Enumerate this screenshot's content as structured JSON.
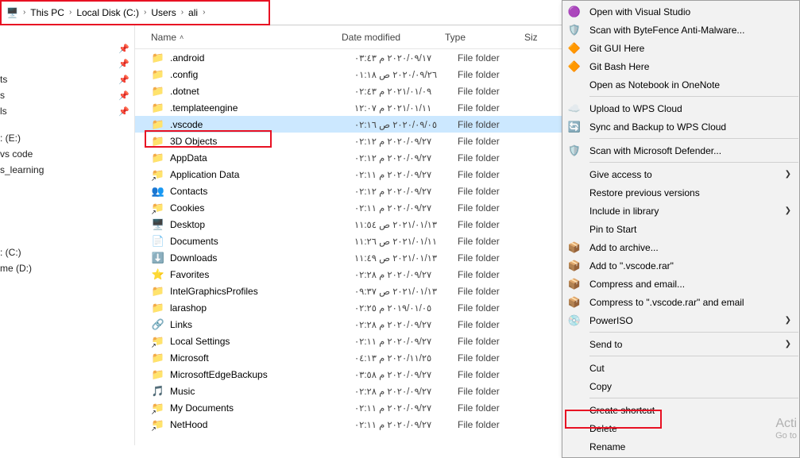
{
  "breadcrumb": {
    "parts": [
      "This PC",
      "Local Disk (C:)",
      "Users",
      "ali"
    ]
  },
  "sidebar": {
    "items": [
      {
        "label": ""
      },
      {
        "label": "",
        "pinned": true
      },
      {
        "label": "",
        "pinned": true
      },
      {
        "label": "ts",
        "pinned": true
      },
      {
        "label": "s",
        "pinned": true
      },
      {
        "label": "ls",
        "pinned": true
      },
      {
        "label": ""
      },
      {
        "label": ": (E:)"
      },
      {
        "label": "vs code"
      },
      {
        "label": "s_learning"
      },
      {
        "label": ""
      },
      {
        "label": ""
      },
      {
        "label": ""
      },
      {
        "label": ""
      },
      {
        "label": ""
      },
      {
        "label": ""
      },
      {
        "label": ": (C:)"
      },
      {
        "label": "me (D:)"
      }
    ]
  },
  "columns": {
    "name": "Name",
    "date": "Date modified",
    "type": "Type",
    "size": "Siz"
  },
  "files": [
    {
      "icon": "folder",
      "name": ".android",
      "date": "٢٠٢٠/٠٩/١٧ م ٠٣:٤٣",
      "type": "File folder"
    },
    {
      "icon": "folder",
      "name": ".config",
      "date": "٢٠٢٠/٠٩/٢٦ ص ٠١:١٨",
      "type": "File folder"
    },
    {
      "icon": "folder",
      "name": ".dotnet",
      "date": "٢٠٢١/٠١/٠٩ م ٠٢:٤٣",
      "type": "File folder"
    },
    {
      "icon": "folder",
      "name": ".templateengine",
      "date": "٢٠٢١/٠١/١١ م ١٢:٠٧",
      "type": "File folder"
    },
    {
      "icon": "folder",
      "name": ".vscode",
      "date": "٢٠٢٠/٠٩/٠٥ ص ٠٢:١٦",
      "type": "File folder",
      "selected": true
    },
    {
      "icon": "folder",
      "name": "3D Objects",
      "date": "٢٠٢٠/٠٩/٢٧ م ٠٢:١٢",
      "type": "File folder"
    },
    {
      "icon": "folder",
      "name": "AppData",
      "date": "٢٠٢٠/٠٩/٢٧ م ٠٢:١٢",
      "type": "File folder"
    },
    {
      "icon": "shortcut",
      "name": "Application Data",
      "date": "٢٠٢٠/٠٩/٢٧ م ٠٢:١١",
      "type": "File folder"
    },
    {
      "icon": "contacts",
      "name": "Contacts",
      "date": "٢٠٢٠/٠٩/٢٧ م ٠٢:١٢",
      "type": "File folder"
    },
    {
      "icon": "shortcut",
      "name": "Cookies",
      "date": "٢٠٢٠/٠٩/٢٧ م ٠٢:١١",
      "type": "File folder"
    },
    {
      "icon": "desktop",
      "name": "Desktop",
      "date": "٢٠٢١/٠١/١٣ ص ١١:٥٤",
      "type": "File folder"
    },
    {
      "icon": "documents",
      "name": "Documents",
      "date": "٢٠٢١/٠١/١١ ص ١١:٢٦",
      "type": "File folder"
    },
    {
      "icon": "downloads",
      "name": "Downloads",
      "date": "٢٠٢١/٠١/١٣ ص ١١:٤٩",
      "type": "File folder"
    },
    {
      "icon": "favorites",
      "name": "Favorites",
      "date": "٢٠٢٠/٠٩/٢٧ م ٠٢:٢٨",
      "type": "File folder"
    },
    {
      "icon": "folder",
      "name": "IntelGraphicsProfiles",
      "date": "٢٠٢١/٠١/١٣ ص ٠٩:٣٧",
      "type": "File folder"
    },
    {
      "icon": "folder",
      "name": "larashop",
      "date": "٢٠١٩/٠١/٠٥ م ٠٢:٢٥",
      "type": "File folder"
    },
    {
      "icon": "links",
      "name": "Links",
      "date": "٢٠٢٠/٠٩/٢٧ م ٠٢:٢٨",
      "type": "File folder"
    },
    {
      "icon": "shortcut",
      "name": "Local Settings",
      "date": "٢٠٢٠/٠٩/٢٧ م ٠٢:١١",
      "type": "File folder"
    },
    {
      "icon": "folder",
      "name": "Microsoft",
      "date": "٢٠٢٠/١١/٢٥ م ٠٤:١٣",
      "type": "File folder"
    },
    {
      "icon": "folder",
      "name": "MicrosoftEdgeBackups",
      "date": "٢٠٢٠/٠٩/٢٧ م ٠٣:٥٨",
      "type": "File folder"
    },
    {
      "icon": "music",
      "name": "Music",
      "date": "٢٠٢٠/٠٩/٢٧ م ٠٢:٢٨",
      "type": "File folder"
    },
    {
      "icon": "shortcut",
      "name": "My Documents",
      "date": "٢٠٢٠/٠٩/٢٧ م ٠٢:١١",
      "type": "File folder"
    },
    {
      "icon": "shortcut",
      "name": "NetHood",
      "date": "٢٠٢٠/٠٩/٢٧ م ٠٢:١١",
      "type": "File folder"
    }
  ],
  "menu": {
    "items": [
      {
        "icon": "vs",
        "label": "Open with Visual Studio"
      },
      {
        "icon": "byte",
        "label": "Scan with ByteFence Anti-Malware..."
      },
      {
        "icon": "git",
        "label": "Git GUI Here"
      },
      {
        "icon": "git",
        "label": "Git Bash Here"
      },
      {
        "icon": "",
        "label": "Open as Notebook in OneNote"
      },
      {
        "sep": true
      },
      {
        "icon": "cloud",
        "label": "Upload to WPS Cloud"
      },
      {
        "icon": "sync",
        "label": "Sync and Backup to WPS Cloud"
      },
      {
        "sep": true
      },
      {
        "icon": "shield",
        "label": "Scan with Microsoft Defender..."
      },
      {
        "sep": true
      },
      {
        "icon": "",
        "label": "Give access to",
        "sub": true
      },
      {
        "icon": "",
        "label": "Restore previous versions"
      },
      {
        "icon": "",
        "label": "Include in library",
        "sub": true
      },
      {
        "icon": "",
        "label": "Pin to Start"
      },
      {
        "icon": "rar",
        "label": "Add to archive..."
      },
      {
        "icon": "rar",
        "label": "Add to \".vscode.rar\""
      },
      {
        "icon": "rar",
        "label": "Compress and email..."
      },
      {
        "icon": "rar",
        "label": "Compress to \".vscode.rar\" and email"
      },
      {
        "icon": "poweriso",
        "label": "PowerISO",
        "sub": true
      },
      {
        "sep": true
      },
      {
        "icon": "",
        "label": "Send to",
        "sub": true
      },
      {
        "sep": true
      },
      {
        "icon": "",
        "label": "Cut"
      },
      {
        "icon": "",
        "label": "Copy"
      },
      {
        "sep": true
      },
      {
        "icon": "",
        "label": "Create shortcut"
      },
      {
        "icon": "",
        "label": "Delete"
      },
      {
        "icon": "",
        "label": "Rename"
      }
    ]
  },
  "watermark": {
    "line1": "Acti",
    "line2": "Go to"
  }
}
